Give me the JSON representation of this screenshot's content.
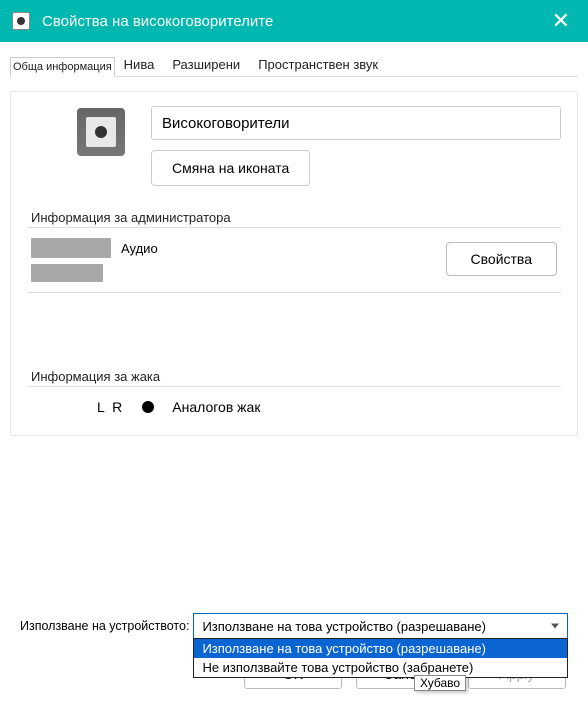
{
  "window": {
    "title": "Свойства на високоговорителите"
  },
  "tabs": {
    "general": "Обща информация",
    "levels": "Нива",
    "advanced": "Разширени",
    "spatial": "Пространствен звук"
  },
  "device": {
    "name_value": "Високоговорители",
    "change_icon_label": "Смяна на иконата"
  },
  "admin": {
    "group_label": "Информация за администратора",
    "line1_suffix": "Аудио",
    "properties_label": "Свойства"
  },
  "jack": {
    "group_label": "Информация за жака",
    "lr": "L R",
    "text": "Аналогов жак"
  },
  "usage": {
    "label": "Използване на устройството:",
    "selected": "Използване на това устройство (разрешаване)",
    "options": {
      "enable": "Използване на това устройство (разрешаване)",
      "disable": "Не използвайте това устройство (забранете)"
    }
  },
  "buttons": {
    "ok": "OK",
    "cancel": "Cancel",
    "apply": "Apply"
  },
  "tooltip": "Хубаво"
}
